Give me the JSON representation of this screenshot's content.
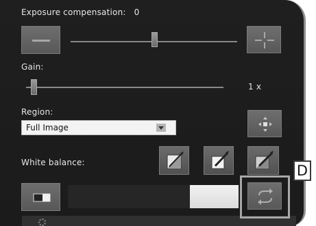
{
  "exposure": {
    "label": "Exposure compensation:",
    "value": "0",
    "minus_icon": "minus-icon",
    "plus_icon": "plus-icon"
  },
  "gain": {
    "label": "Gain:",
    "value": "1 x"
  },
  "region": {
    "label": "Region:",
    "selected": "Full Image",
    "center_icon": "center-target-icon"
  },
  "white_balance": {
    "label": "White balance:",
    "buttons": [
      "wb-auto-icon",
      "wb-eyedropper-icon",
      "wb-eyedropper-alt-icon"
    ]
  },
  "bottom_row": {
    "toggle_icon": "split-view-icon",
    "refresh_icon": "refresh-icon"
  },
  "callout": {
    "letter": "D"
  },
  "colors": {
    "panel_bg": "#1e1e1e",
    "button_bg": "#666666",
    "text": "#e8e8e8",
    "highlight": "#a8a8a8"
  }
}
